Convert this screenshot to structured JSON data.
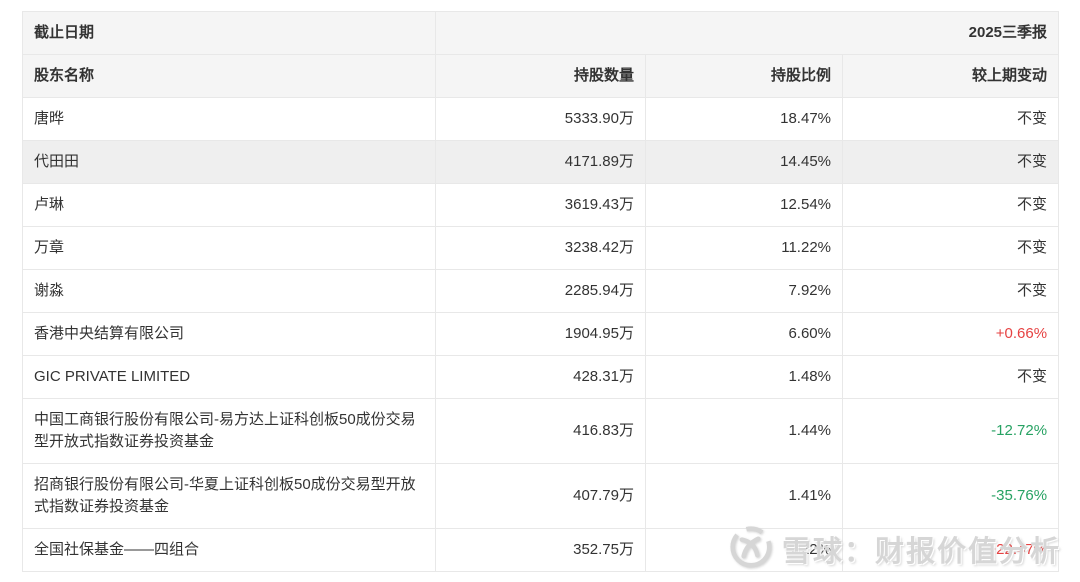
{
  "table": {
    "period_row": {
      "label": "截止日期",
      "value": "2025三季报"
    },
    "columns": [
      "股东名称",
      "持股数量",
      "持股比例",
      "较上期变动"
    ],
    "rows": [
      {
        "name": "唐晔",
        "shares": "5333.90万",
        "ratio": "18.47%",
        "change": "不变",
        "change_type": "flat",
        "highlight": false
      },
      {
        "name": "代田田",
        "shares": "4171.89万",
        "ratio": "14.45%",
        "change": "不变",
        "change_type": "flat",
        "highlight": true
      },
      {
        "name": "卢琳",
        "shares": "3619.43万",
        "ratio": "12.54%",
        "change": "不变",
        "change_type": "flat",
        "highlight": false
      },
      {
        "name": "万章",
        "shares": "3238.42万",
        "ratio": "11.22%",
        "change": "不变",
        "change_type": "flat",
        "highlight": false
      },
      {
        "name": "谢淼",
        "shares": "2285.94万",
        "ratio": "7.92%",
        "change": "不变",
        "change_type": "flat",
        "highlight": false
      },
      {
        "name": "香港中央结算有限公司",
        "shares": "1904.95万",
        "ratio": "6.60%",
        "change": "+0.66%",
        "change_type": "up",
        "highlight": false
      },
      {
        "name": "GIC PRIVATE LIMITED",
        "shares": "428.31万",
        "ratio": "1.48%",
        "change": "不变",
        "change_type": "flat",
        "highlight": false
      },
      {
        "name": "中国工商银行股份有限公司-易方达上证科创板50成份交易型开放式指数证券投资基金",
        "shares": "416.83万",
        "ratio": "1.44%",
        "change": "-12.72%",
        "change_type": "down",
        "highlight": false
      },
      {
        "name": "招商银行股份有限公司-华夏上证科创板50成份交易型开放式指数证券投资基金",
        "shares": "407.79万",
        "ratio": "1.41%",
        "change": "-35.76%",
        "change_type": "down",
        "highlight": false
      },
      {
        "name": "全国社保基金——四组合",
        "shares": "352.75万",
        "ratio": "1.22%",
        "change": "+22.47%",
        "change_type": "up",
        "highlight": false
      }
    ]
  },
  "watermark": {
    "text": "雪球：财报价值分析",
    "logo": "xueqiu-snowball-logo"
  },
  "colors": {
    "up_red": "#e64242",
    "down_green": "#27a263",
    "header_bg": "#f5f5f5",
    "hover_row_bg": "#efefef",
    "border": "#e8e8e8",
    "text": "#333333",
    "watermark": "#d6d6d6"
  }
}
